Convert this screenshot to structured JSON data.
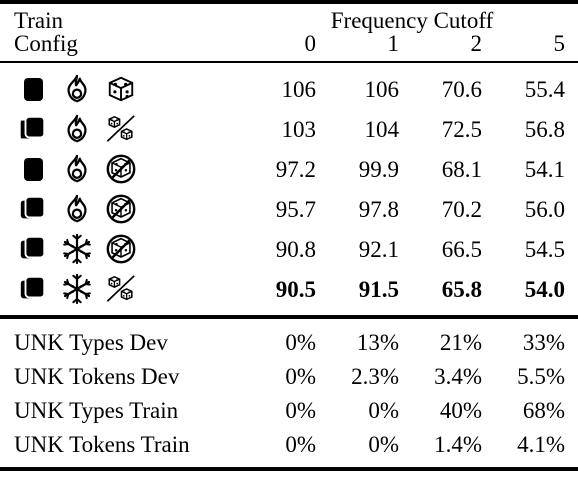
{
  "table": {
    "header": {
      "left_line1": "Train",
      "left_line2": "Config",
      "group_label": "Frequency Cutoff",
      "columns": [
        "0",
        "1",
        "2",
        "5"
      ]
    },
    "rows": [
      {
        "icons": [
          "single-card-icon",
          "fire-icon",
          "dice-icon"
        ],
        "values": [
          "106",
          "106",
          "70.6",
          "55.4"
        ],
        "bold": false
      },
      {
        "icons": [
          "double-card-icon",
          "fire-icon",
          "dice-slashed-icon"
        ],
        "values": [
          "103",
          "104",
          "72.5",
          "56.8"
        ],
        "bold": false
      },
      {
        "icons": [
          "single-card-icon",
          "fire-icon",
          "dice-prohibited-icon"
        ],
        "values": [
          "97.2",
          "99.9",
          "68.1",
          "54.1"
        ],
        "bold": false
      },
      {
        "icons": [
          "double-card-icon",
          "fire-icon",
          "dice-prohibited-icon"
        ],
        "values": [
          "95.7",
          "97.8",
          "70.2",
          "56.0"
        ],
        "bold": false
      },
      {
        "icons": [
          "double-card-icon",
          "snowflake-icon",
          "dice-prohibited-icon"
        ],
        "values": [
          "90.8",
          "92.1",
          "66.5",
          "54.5"
        ],
        "bold": false
      },
      {
        "icons": [
          "double-card-icon",
          "snowflake-icon",
          "dice-slashed-icon"
        ],
        "values": [
          "90.5",
          "91.5",
          "65.8",
          "54.0"
        ],
        "bold": true
      }
    ],
    "unk_rows": [
      {
        "label": "UNK Types Dev",
        "values": [
          "0%",
          "13%",
          "21%",
          "33%"
        ]
      },
      {
        "label": "UNK Tokens Dev",
        "values": [
          "0%",
          "2.3%",
          "3.4%",
          "5.5%"
        ]
      },
      {
        "label": "UNK Types Train",
        "values": [
          "0%",
          "0%",
          "40%",
          "68%"
        ]
      },
      {
        "label": "UNK Tokens Train",
        "values": [
          "0%",
          "0%",
          "1.4%",
          "4.1%"
        ]
      }
    ]
  },
  "colors": {
    "ink": "#000000",
    "paper": "#ffffff"
  }
}
